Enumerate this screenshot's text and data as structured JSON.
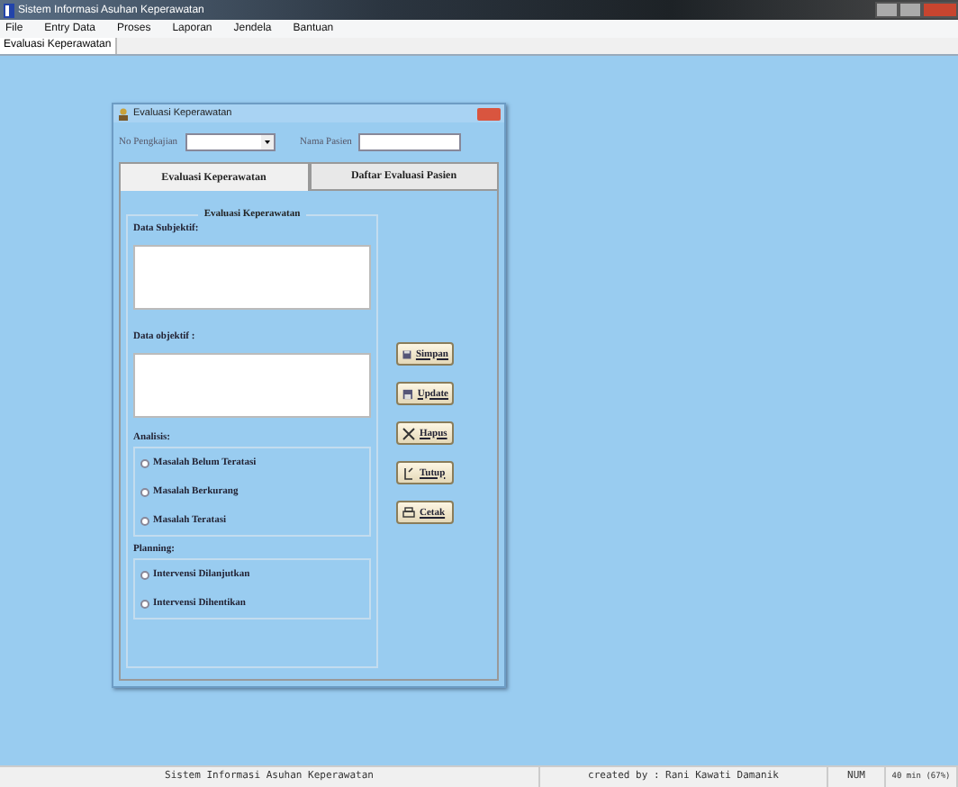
{
  "window": {
    "title": "Sistem Informasi Asuhan Keperawatan"
  },
  "menu": [
    "File",
    "Entry Data",
    "Proses",
    "Laporan",
    "Jendela",
    "Bantuan"
  ],
  "doc_tabs": [
    {
      "label": "Evaluasi Keperawatan",
      "selected": true
    }
  ],
  "dialog": {
    "title": "Evaluasi Keperawatan",
    "fields": [
      {
        "kind": "combo",
        "label": "No Pengkajian"
      },
      {
        "kind": "text",
        "label": "Nama Pasien"
      }
    ],
    "tabs": [
      {
        "label": "Evaluasi Keperawatan",
        "selected": true
      },
      {
        "label": "Daftar Evaluasi Pasien",
        "selected": false
      }
    ],
    "group_title": "Evaluasi Keperawatan",
    "subjective_label": "Data Subjektif:",
    "objective_label": "Data objektif :",
    "analysis": {
      "label": "Analisis:",
      "options": [
        {
          "label": "Masalah Belum Teratasi",
          "selected": false
        },
        {
          "label": "Masalah Berkurang",
          "selected": false
        },
        {
          "label": "Masalah Teratasi",
          "selected": false
        }
      ]
    },
    "planning": {
      "label": "Planning:",
      "options": [
        {
          "label": "Intervensi Dilanjutkan",
          "selected": false
        },
        {
          "label": "Intervensi Dihentikan",
          "selected": false
        }
      ]
    },
    "buttons": [
      {
        "kind": "save",
        "label": "Simpan"
      },
      {
        "kind": "update",
        "label": "Update"
      },
      {
        "kind": "delete",
        "label": "Hapus"
      },
      {
        "kind": "close",
        "label": "Tutup"
      },
      {
        "kind": "print",
        "label": "Cetak"
      }
    ]
  },
  "status_bar": [
    "Sistem Informasi Asuhan Keperawatan",
    "created by : Rani Kawati Damanik",
    "NUM",
    "40 min (67%)"
  ]
}
